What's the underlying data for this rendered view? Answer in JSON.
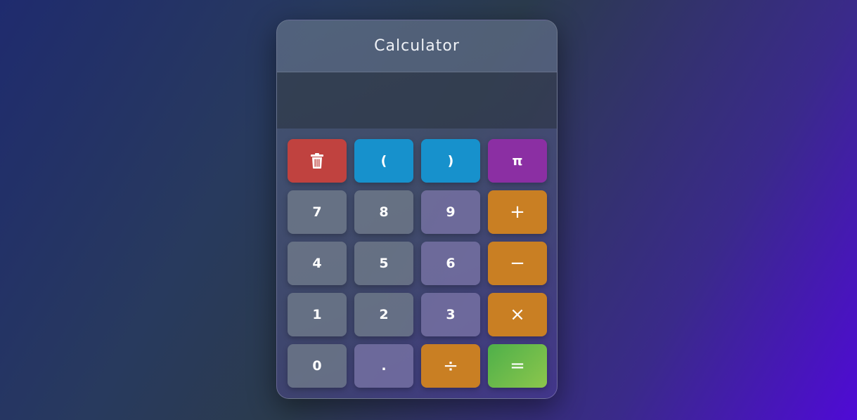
{
  "app": {
    "title": "Calculator",
    "display_value": ""
  },
  "keys": {
    "clear": {
      "icon": "trash-icon"
    },
    "open_paren": "(",
    "close_paren": ")",
    "pi": "π",
    "seven": "7",
    "eight": "8",
    "nine": "9",
    "plus": "+",
    "four": "4",
    "five": "5",
    "six": "6",
    "minus": "−",
    "one": "1",
    "two": "2",
    "three": "3",
    "multiply": "×",
    "zero": "0",
    "decimal": ".",
    "divide": "÷",
    "equals": "="
  },
  "colors": {
    "clear": "#c0423f",
    "paren": "#1791cc",
    "pi": "#8b2fa3",
    "operator": "#c97f23",
    "equals": "#6cbb4b"
  }
}
